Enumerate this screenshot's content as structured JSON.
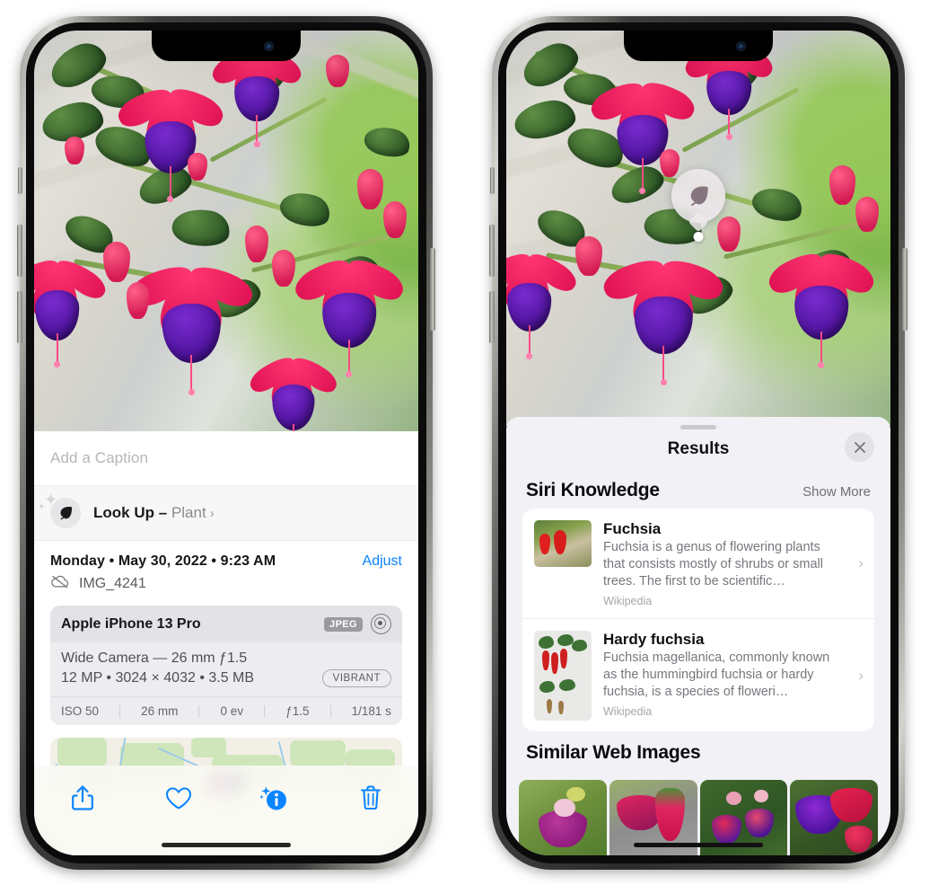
{
  "left_phone": {
    "caption": {
      "placeholder": "Add a Caption",
      "value": ""
    },
    "lookup": {
      "label": "Look Up",
      "dash": "–",
      "subject": "Plant",
      "chevron": "›",
      "icon": "leaf-icon"
    },
    "date": {
      "text": "Monday • May 30, 2022 • 9:23 AM",
      "adjust_label": "Adjust"
    },
    "file": {
      "name": "IMG_4241",
      "icon": "icloud-slash-icon"
    },
    "camera": {
      "model": "Apple iPhone 13 Pro",
      "format_badge": "JPEG",
      "raw_icon": "aperture-ring-icon",
      "lens_line": "Wide Camera — 26 mm ƒ1.5",
      "specs_line": "12 MP • 3024 × 4032 • 3.5 MB",
      "style_badge": "VIBRANT",
      "exif": [
        "ISO 50",
        "26 mm",
        "0 ev",
        "ƒ1.5",
        "1/181 s"
      ]
    },
    "toolbar": [
      {
        "name": "share-button",
        "icon": "share-icon"
      },
      {
        "name": "favorite-button",
        "icon": "heart-icon"
      },
      {
        "name": "info-button",
        "icon": "info-sparkle-icon"
      },
      {
        "name": "delete-button",
        "icon": "trash-icon"
      }
    ],
    "accent_color": "#0a84ff"
  },
  "right_phone": {
    "visual_lookup_badge": {
      "icon": "leaf-icon"
    },
    "sheet": {
      "title": "Results",
      "close_icon": "close-icon",
      "sections": [
        {
          "title": "Siri Knowledge",
          "action_label": "Show More",
          "cards": [
            {
              "title": "Fuchsia",
              "description": "Fuchsia is a genus of flowering plants that consists mostly of shrubs or small trees. The first to be scientific…",
              "source": "Wikipedia",
              "chevron": "›"
            },
            {
              "title": "Hardy fuchsia",
              "description": "Fuchsia magellanica, commonly known as the hummingbird fuchsia or hardy fuchsia, is a species of floweri…",
              "source": "Wikipedia",
              "chevron": "›"
            }
          ]
        },
        {
          "title": "Similar Web Images",
          "thumbnails": [
            "web-image-1",
            "web-image-2",
            "web-image-3",
            "web-image-4"
          ]
        }
      ]
    }
  }
}
